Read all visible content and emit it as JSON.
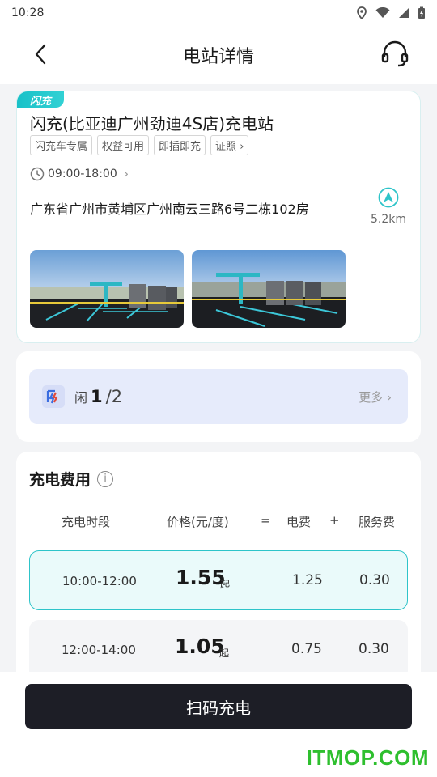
{
  "status_bar": {
    "time": "10:28"
  },
  "header": {
    "title": "电站详情"
  },
  "station": {
    "badge": "闪充",
    "name": "闪充(比亚迪广州劲迪4S店)充电站",
    "tags": [
      "闪充车专属",
      "权益可用",
      "即插即充",
      "证照"
    ],
    "hours": "09:00-18:00",
    "address": "广东省广州市黄埔区广州南云三路6号二栋102房",
    "distance": "5.2km"
  },
  "charger_status": {
    "label": "闲",
    "available": "1",
    "total": "/2",
    "more": "更多"
  },
  "fees": {
    "title": "充电费用",
    "headers": {
      "period": "充电时段",
      "price": "价格(元/度)",
      "eq": "=",
      "elec": "电费",
      "plus": "+",
      "service": "服务费"
    },
    "rows": [
      {
        "period": "10:00-12:00",
        "price": "1.55",
        "suffix": "起",
        "elec": "1.25",
        "service": "0.30"
      },
      {
        "period": "12:00-14:00",
        "price": "1.05",
        "suffix": "起",
        "elec": "0.75",
        "service": "0.30"
      }
    ]
  },
  "action": {
    "scan_label": "扫码充电"
  },
  "watermark": "ITMOP.COM",
  "colors": {
    "accent": "#2ec4c9",
    "button": "#1d1e26",
    "status_bg": "#e6ebfb"
  }
}
